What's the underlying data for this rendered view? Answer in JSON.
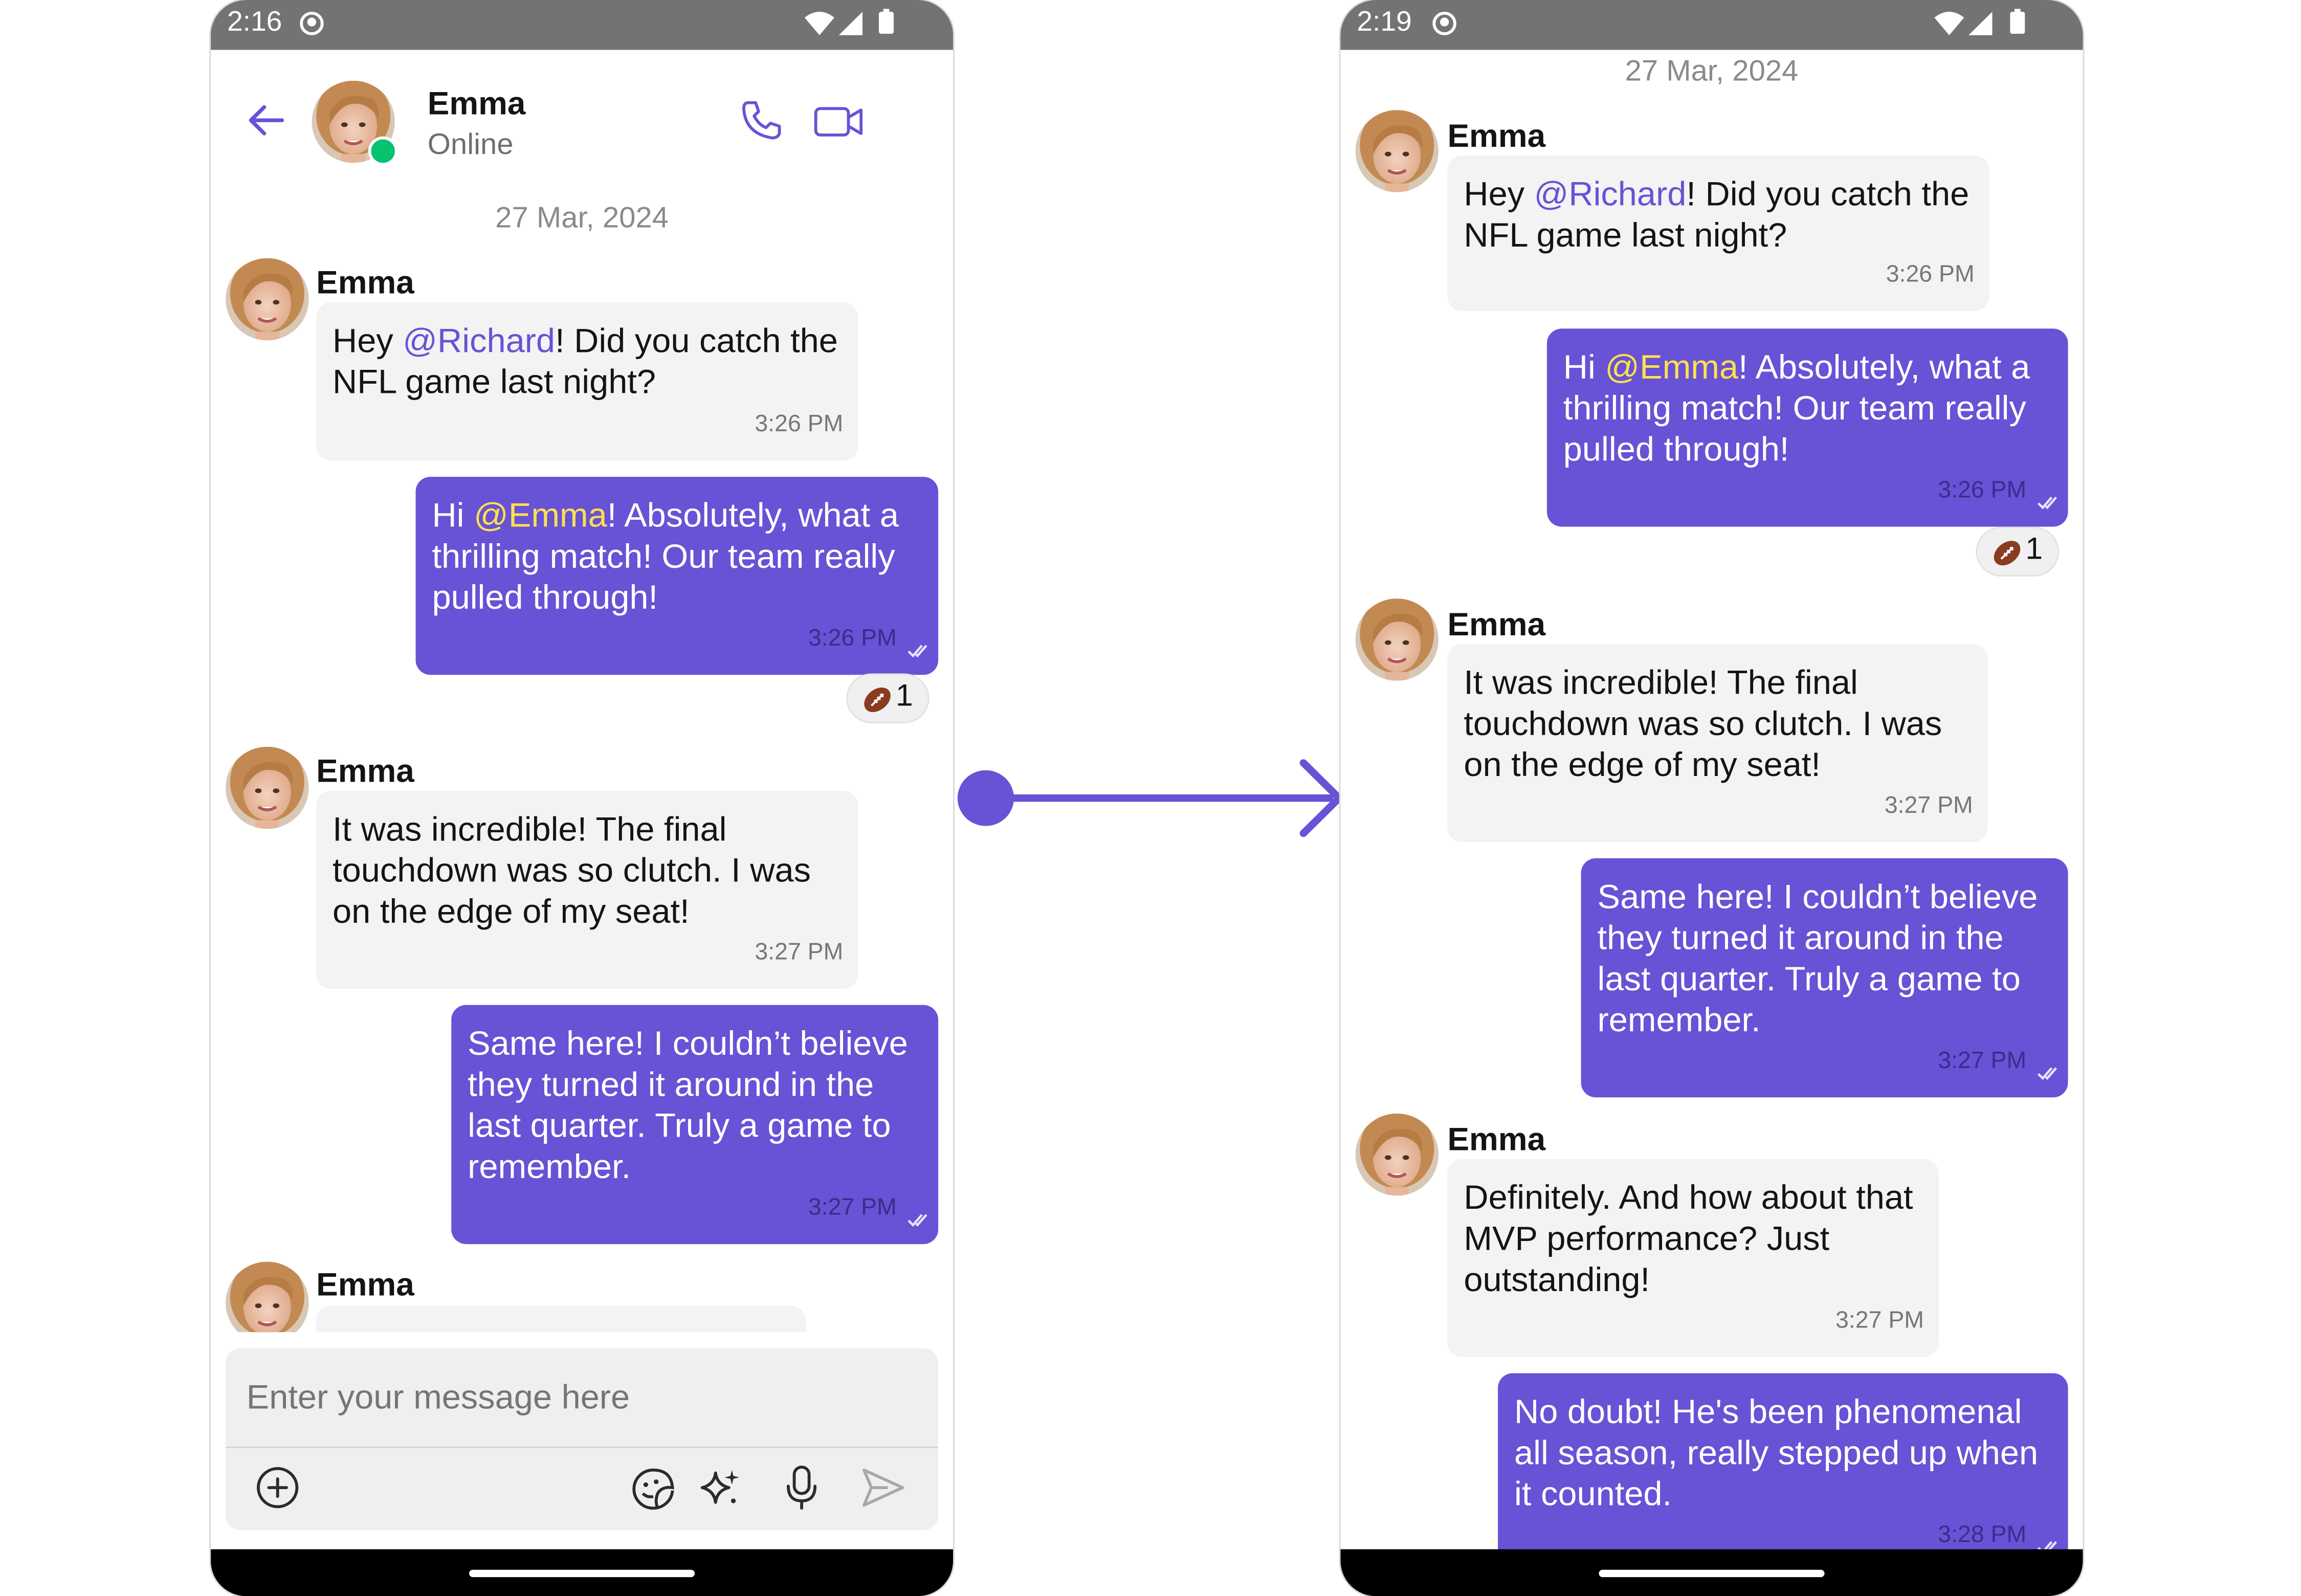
{
  "left_screen": {
    "status_time": "2:16",
    "header": {
      "name": "Emma",
      "status": "Online"
    },
    "date_separator": "27 Mar, 2024",
    "messages": [
      {
        "sender": "Emma",
        "text_before": "Hey ",
        "mention": "@Richard",
        "text_after": "! Did you catch the NFL game last night?",
        "time": "3:26 PM"
      },
      {
        "text_before": "Hi ",
        "mention": "@Emma",
        "text_after": "! Absolutely, what a thrilling match! Our team really pulled through!",
        "time": "3:26 PM",
        "reaction_count": "1"
      },
      {
        "sender": "Emma",
        "text": "It was incredible! The final touchdown was so clutch. I was on the edge of my seat!",
        "time": "3:27 PM"
      },
      {
        "text": "Same here! I couldn’t believe they turned it around in the last quarter. Truly a game to remember.",
        "time": "3:27 PM"
      },
      {
        "sender": "Emma"
      }
    ],
    "composer": {
      "placeholder": "Enter your message here"
    }
  },
  "right_screen": {
    "status_time": "2:19",
    "date_separator": "27 Mar, 2024",
    "messages": [
      {
        "sender": "Emma",
        "text_before": "Hey ",
        "mention": "@Richard",
        "text_after": "! Did you catch the NFL game last night?",
        "time": "3:26 PM"
      },
      {
        "text_before": "Hi ",
        "mention": "@Emma",
        "text_after": "! Absolutely, what a thrilling match! Our team really pulled through!",
        "time": "3:26 PM",
        "reaction_count": "1"
      },
      {
        "sender": "Emma",
        "text": "It was incredible! The final touchdown was so clutch. I was on the edge of my seat!",
        "time": "3:27 PM"
      },
      {
        "text": "Same here! I couldn’t believe they turned it around in the last quarter. Truly a game to remember.",
        "time": "3:27 PM"
      },
      {
        "sender": "Emma",
        "text": "Definitely. And how about that MVP performance? Just outstanding!",
        "time": "3:27 PM"
      },
      {
        "text": "No doubt! He's been phenomenal all season, really stepped up when it counted.",
        "time": "3:28 PM"
      }
    ]
  },
  "icons": {
    "back": "arrow-left-icon",
    "call": "phone-icon",
    "video": "video-camera-icon",
    "attach": "plus-circle-icon",
    "sticker": "sticker-icon",
    "ai": "sparkles-icon",
    "mic": "microphone-icon",
    "send": "send-icon",
    "reaction_emoji": "american-football-icon",
    "read_receipt": "double-check-icon"
  },
  "colors": {
    "accent": "#6852d6",
    "mention_in": "#6852d6",
    "mention_out": "#ffe14d",
    "online": "#09c26f",
    "incoming_bubble": "#f3f3f3",
    "status_bar": "#737373"
  }
}
